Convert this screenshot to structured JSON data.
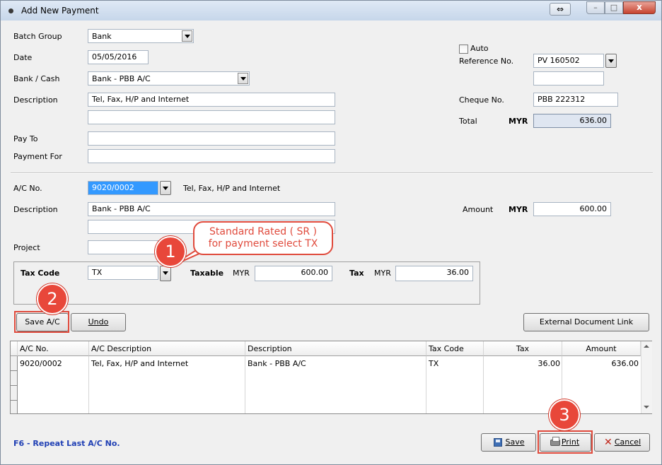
{
  "window": {
    "title": "Add New Payment",
    "restore_glyph": "⇔",
    "minimize_glyph": "–",
    "maximize_glyph": "□",
    "close_glyph": "x"
  },
  "header": {
    "batch_group_label": "Batch Group",
    "batch_group_value": "Bank",
    "date_label": "Date",
    "date_value": "05/05/2016",
    "bank_cash_label": "Bank / Cash",
    "bank_cash_value": "Bank - PBB A/C",
    "description_label": "Description",
    "description_value": "Tel, Fax, H/P and Internet",
    "description_line2": "",
    "pay_to_label": "Pay To",
    "pay_to_value": "",
    "payment_for_label": "Payment For",
    "payment_for_value": "",
    "auto_label": "Auto",
    "auto_checked": false,
    "reference_no_label": "Reference No.",
    "reference_no_value": "PV 160502",
    "reference_no_line2": "",
    "cheque_no_label": "Cheque No.",
    "cheque_no_value": "PBB 222312",
    "total_label": "Total",
    "total_currency": "MYR",
    "total_value": "636.00"
  },
  "detail": {
    "ac_no_label": "A/C No.",
    "ac_no_value": "9020/0002",
    "ac_name": "Tel, Fax, H/P and Internet",
    "description_label": "Description",
    "description_value": "Bank - PBB A/C",
    "description_line2": "",
    "project_label": "Project",
    "project_value": "",
    "amount_label": "Amount",
    "amount_currency": "MYR",
    "amount_value": "600.00",
    "tax_code_label": "Tax Code",
    "tax_code_value": "TX",
    "taxable_label": "Taxable",
    "taxable_currency": "MYR",
    "taxable_value": "600.00",
    "tax_label": "Tax",
    "tax_currency": "MYR",
    "tax_value": "36.00"
  },
  "buttons": {
    "save_ac": "Save A/C",
    "undo": "Undo",
    "external_document_link": "External Document Link",
    "save": "Save",
    "print": "Print",
    "cancel": "Cancel"
  },
  "grid": {
    "columns": [
      "A/C No.",
      "A/C Description",
      "Description",
      "Tax Code",
      "Tax",
      "Amount"
    ],
    "rows": [
      [
        "9020/0002",
        "Tel, Fax, H/P and Internet",
        "Bank - PBB A/C",
        "TX",
        "36.00",
        "636.00"
      ]
    ]
  },
  "footer": {
    "hint": "F6 - Repeat Last A/C No.",
    "hint_color": "#1f3fb4"
  },
  "annotations": {
    "callout_line1": "Standard Rated ( SR )",
    "callout_line2": "for payment select TX",
    "badge1": "1",
    "badge2": "2",
    "badge3": "3",
    "accent_color": "#e8473a"
  }
}
